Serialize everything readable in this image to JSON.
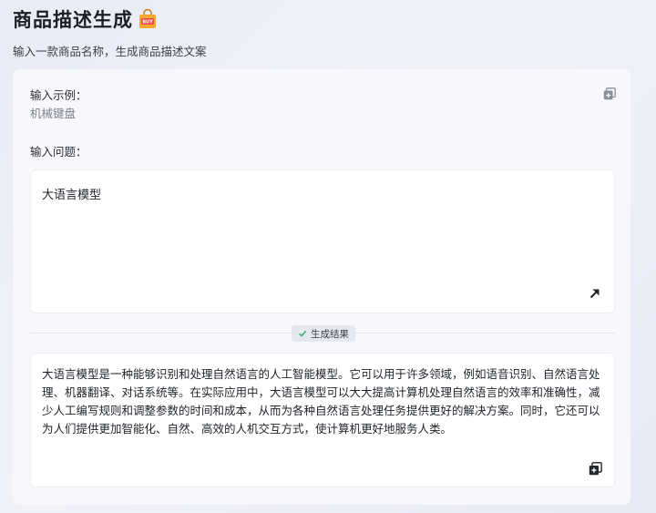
{
  "header": {
    "title": "商品描述生成",
    "subtitle": "输入一款商品名称，生成商品描述文案",
    "badge_text": "BUY"
  },
  "example": {
    "label": "输入示例：",
    "value": "机械键盘"
  },
  "question": {
    "label": "输入问题：",
    "value": "大语言模型"
  },
  "result": {
    "tag_label": "生成结果",
    "text": "大语言模型是一种能够识别和处理自然语言的人工智能模型。它可以用于许多领域，例如语音识别、自然语言处理、机器翻译、对话系统等。在实际应用中，大语言模型可以大大提高计算机处理自然语言的效率和准确性，减少人工编写规则和调整参数的时间和成本，从而为各种自然语言处理任务提供更好的解决方案。同时，它还可以为人们提供更加智能化、自然、高效的人机交互方式，使计算机更好地服务人类。"
  },
  "icons": {
    "title": "shopping-bag-icon",
    "copy_example": "copy-icon",
    "expand": "arrow-up-right-icon",
    "check": "check-icon",
    "copy_result": "copy-icon"
  },
  "colors": {
    "accent": "#2b2f36",
    "bag_body": "#f4a92c",
    "bag_badge": "#e8493f",
    "check": "#2fae6b"
  }
}
